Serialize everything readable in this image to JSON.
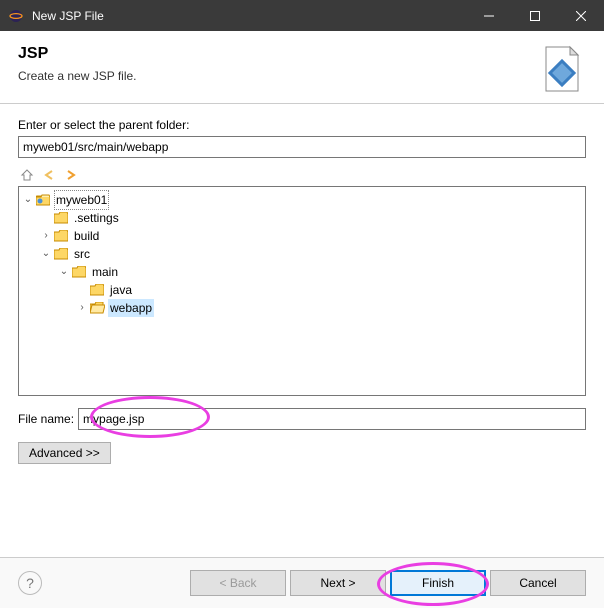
{
  "window": {
    "title": "New JSP File"
  },
  "header": {
    "title": "JSP",
    "desc": "Create a new JSP file."
  },
  "content": {
    "parent_label": "Enter or select the parent folder:",
    "parent_value": "myweb01/src/main/webapp"
  },
  "tree": {
    "root": "myweb01",
    "items": {
      "settings": ".settings",
      "build": "build",
      "src": "src",
      "main": "main",
      "java": "java",
      "webapp": "webapp"
    }
  },
  "filename": {
    "label": "File name:",
    "value": "mypage.jsp"
  },
  "advanced": {
    "label": "Advanced >>"
  },
  "buttons": {
    "back": "< Back",
    "next": "Next >",
    "finish": "Finish",
    "cancel": "Cancel"
  },
  "help": {
    "tooltip": "Help"
  }
}
